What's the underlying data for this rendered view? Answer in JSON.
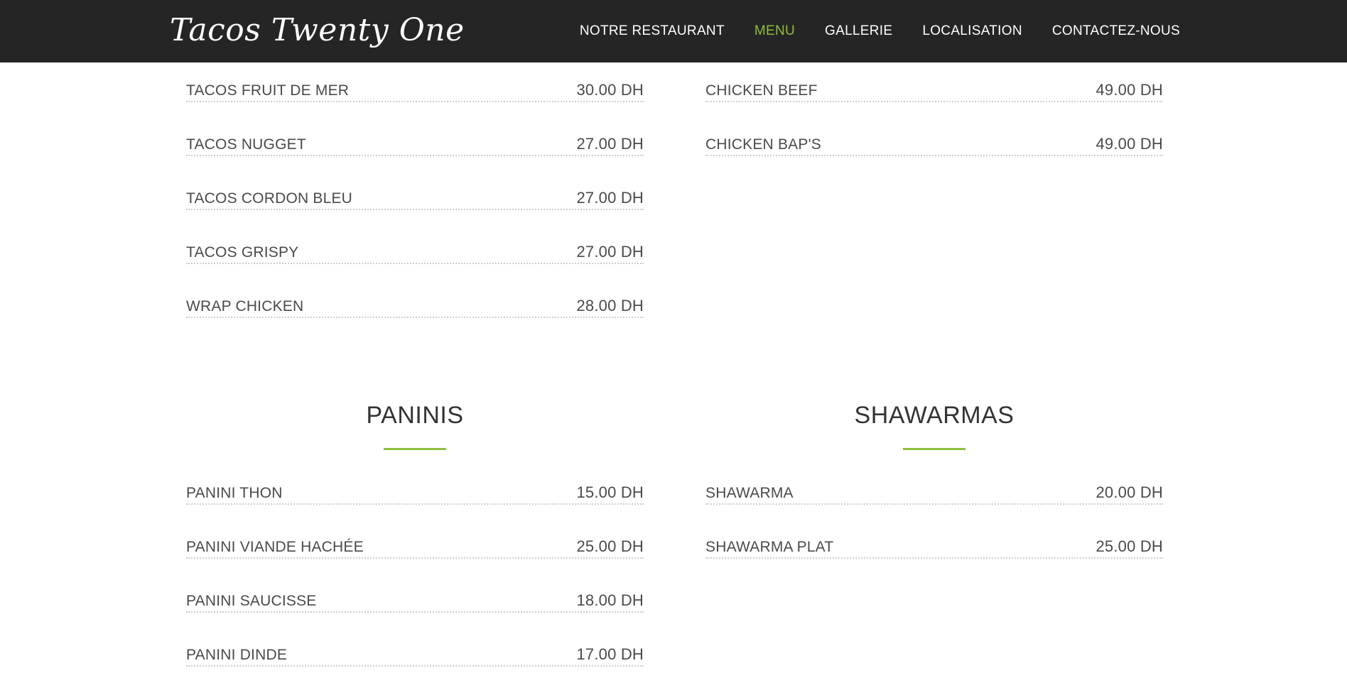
{
  "nav": {
    "brand": "Tacos Twenty One",
    "items": [
      {
        "label": "NOTRE RESTAURANT",
        "active": false
      },
      {
        "label": "MENU",
        "active": true
      },
      {
        "label": "GALLERIE",
        "active": false
      },
      {
        "label": "LOCALISATION",
        "active": false
      },
      {
        "label": "CONTACTEZ-NOUS",
        "active": false
      }
    ]
  },
  "colors": {
    "accent": "#8fbe3f",
    "navbar": "#252525"
  },
  "tacos_left": [
    {
      "name": "TACOS FRUIT DE MER",
      "price": "30.00 DH"
    },
    {
      "name": "TACOS NUGGET",
      "price": "27.00 DH"
    },
    {
      "name": "TACOS CORDON BLEU",
      "price": "27.00 DH"
    },
    {
      "name": "TACOS GRISPY",
      "price": "27.00 DH"
    },
    {
      "name": "WRAP CHICKEN",
      "price": "28.00 DH"
    }
  ],
  "tacos_right": [
    {
      "name": "CHICKEN BEEF",
      "price": "49.00 DH"
    },
    {
      "name": "CHICKEN BAP'S",
      "price": "49.00 DH"
    }
  ],
  "paninis": {
    "title": "PANINIS",
    "items": [
      {
        "name": "PANINI THON",
        "price": "15.00 DH"
      },
      {
        "name": "PANINI VIANDE HACHÉE",
        "price": "25.00 DH"
      },
      {
        "name": "PANINI SAUCISSE",
        "price": "18.00 DH"
      },
      {
        "name": "PANINI DINDE",
        "price": "17.00 DH"
      }
    ]
  },
  "shawarmas": {
    "title": "SHAWARMAS",
    "items": [
      {
        "name": "SHAWARMA",
        "price": "20.00 DH"
      },
      {
        "name": "SHAWARMA PLAT",
        "price": "25.00 DH"
      }
    ]
  }
}
